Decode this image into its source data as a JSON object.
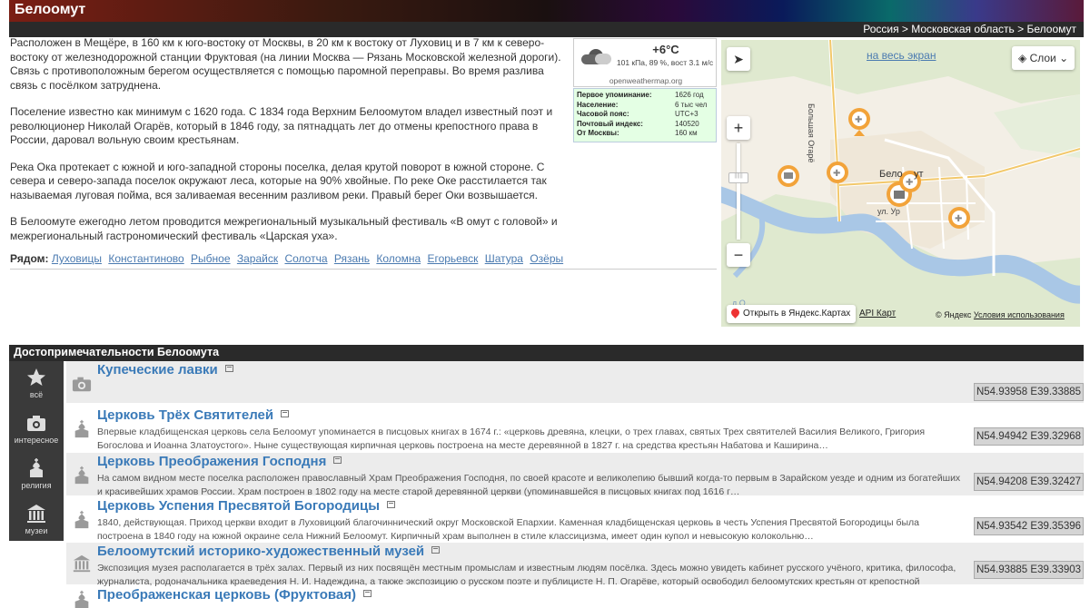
{
  "header": {
    "title": "Белоомут",
    "breadcrumb": "Россия > Московская область > Белоомут"
  },
  "article": {
    "paragraphs": [
      "Расположен в Мещёре, в 160 км к юго-востоку от Москвы, в 20 км к востоку от Луховиц и в 7 км к северо-востоку от железнодорожной станции Фруктовая (на линии Москва — Рязань Московской железной дороги). Связь с противоположным берегом осуществляется с помощью паромной переправы. Во время разлива связь с посёлком затруднена.",
      "Поселение известно как минимум с 1620 года. С 1834 года Верхним Белоомутом владел известный поэт и революционер Николай Огарёв, который в 1846 году, за пятнадцать лет до отмены крепостного права в России, даровал вольную своим крестьянам.",
      "Река Ока протекает с южной и юго-западной стороны поселка, делая крутой поворот в южной стороне. С севера и северо-запада поселок окружают леса, которые на 90% хвойные. По реке Оке расстилается так называемая луговая пойма, вся заливаемая весенним разливом реки. Правый берег Оки возвышается.",
      "В Белоомуте ежегодно летом проводится межрегиональный музыкальный фестиваль «В омут с головой» и межрегиональный гастрономический фестиваль «Царская уха»."
    ],
    "nearby_label": "Рядом:",
    "nearby": [
      "Луховицы",
      "Константиново",
      "Рыбное",
      "Зарайск",
      "Солотча",
      "Рязань",
      "Коломна",
      "Егорьевск",
      "Шатура",
      "Озёры"
    ]
  },
  "weather": {
    "temp": "+6°C",
    "details": "101 кПа, 89 %, вост 3.1 м/с",
    "source": "openweathermap.org"
  },
  "info": [
    {
      "k": "Первое упоминание:",
      "v": "1626 год"
    },
    {
      "k": "Население:",
      "v": "6 тыс чел"
    },
    {
      "k": "Часовой пояс:",
      "v": "UTC+3"
    },
    {
      "k": "Почтовый индекс:",
      "v": "140520"
    },
    {
      "k": "От Москвы:",
      "v": "160 км"
    }
  ],
  "map": {
    "fullscreen": "на весь экран",
    "layers": "Слои",
    "open_yandex": "Открыть в Яндекс.Картах",
    "api": "API Карт",
    "copyright": "© Яндекс",
    "terms": "Условия использования",
    "street1": "Большая Огарё",
    "street2": "ул. Ур",
    "town_label": "Бело",
    "town_label2": "ут",
    "river_label": "д О",
    "zoom_thumb": "||||||"
  },
  "sights": {
    "title": "Достопримечательности Белоомута",
    "filters": [
      {
        "label": "всё",
        "icon": "star-icon"
      },
      {
        "label": "интересное",
        "icon": "camera-icon"
      },
      {
        "label": "религия",
        "icon": "church-icon"
      },
      {
        "label": "музеи",
        "icon": "museum-icon"
      }
    ],
    "items": [
      {
        "title": "Купеческие лавки",
        "desc": "",
        "coords": "N54.93958 E39.33885",
        "icon": "camera-icon"
      },
      {
        "title": "Церковь Трёх Святителей",
        "desc": "Впервые кладбищенская церковь села Белоомут упоминается в писцовых книгах в 1674 г.: «церковь древяна, клецки, о трех главах, святых Трех святителей Василия Великого, Григория Богослова и Иоанна Златоустого». Ныне существующая кирпичная церковь построена на месте деревянной в 1827 г. на средства крестьян Набатова и Каширина…",
        "coords": "N54.94942 E39.32968",
        "icon": "church-icon"
      },
      {
        "title": "Церковь Преображения Господня",
        "desc": "На самом видном месте поселка расположен православный Храм Преображения Господня, по своей красоте и великолепию бывший когда-то первым в Зарайском уезде и одним из богатейших и красивейших храмов России. Храм построен в 1802 году на месте старой деревянной церкви (упоминавшейся в писцовых книгах под 1616 г…",
        "coords": "N54.94208 E39.32427",
        "icon": "church-icon"
      },
      {
        "title": "Церковь Успения Пресвятой Богородицы",
        "desc": "1840, действующая. Приход церкви входит в Луховицкий благочиннический округ Московской Епархии. Каменная кладбищенская церковь в честь Успения Пресвятой Богородицы была построена в 1840 году на южной окраине села Нижний Белоомут. Кирпичный храм выполнен в стиле классицизма, имеет один купол и невысокую колокольню…",
        "coords": "N54.93542 E39.35396",
        "icon": "church-icon"
      },
      {
        "title": "Белоомутский историко-художественный музей",
        "desc": "Экспозиция музея располагается в трёх залах. Первый из них посвящён местным промыслам и известным людям посёлка. Здесь можно увидеть кабинет русского учёного, критика, философа, журналиста, родоначальника краеведения Н. И. Надеждина, а также экспозицию о русском поэте и публицисте Н. П. Огарёве, который освободил белоомутских крестьян от крепостной",
        "coords": "N54.93885 E39.33903",
        "icon": "museum-icon"
      },
      {
        "title": "Преображенская церковь (Фруктовая)",
        "desc": "",
        "coords": "",
        "icon": "church-icon"
      }
    ]
  }
}
